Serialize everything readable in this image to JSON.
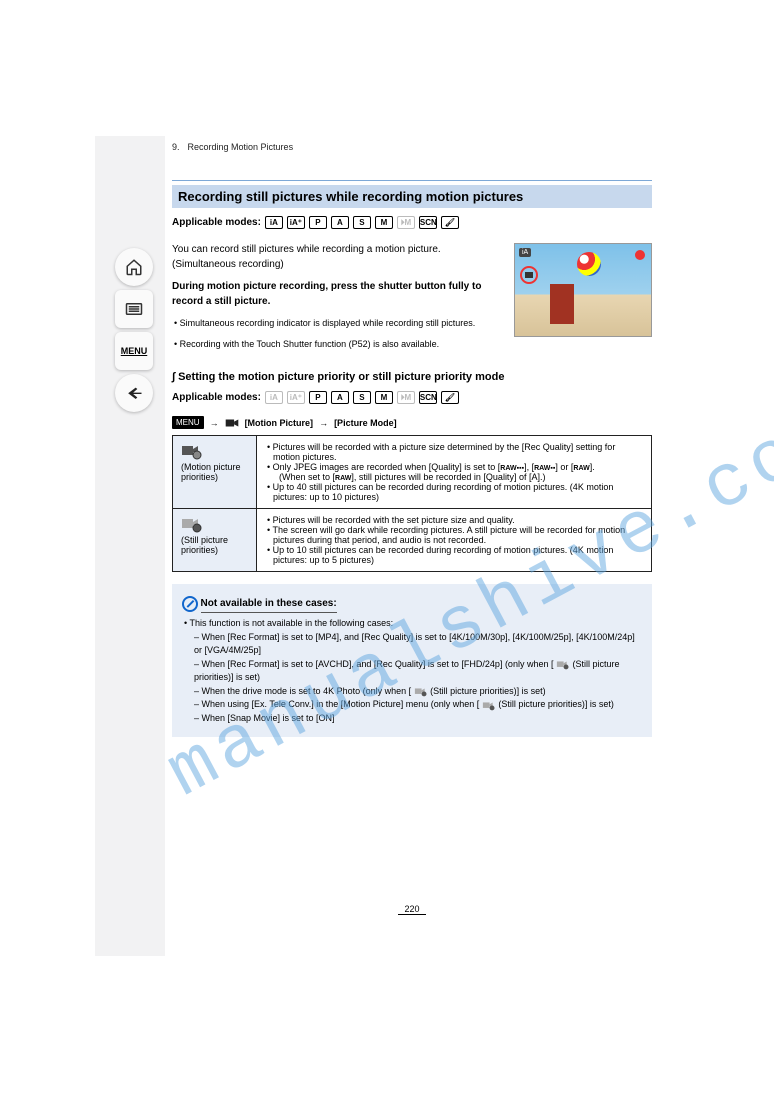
{
  "header": {
    "left": "Recording Motion Pictures",
    "right": "9."
  },
  "nav": {
    "menu_label": "MENU"
  },
  "section1": {
    "title": "Recording still pictures while recording motion pictures",
    "applicable_label": "Applicable modes:",
    "modes": [
      "iA",
      "iA+",
      "P",
      "A",
      "S",
      "M",
      "vM",
      "SCN",
      "CrA"
    ],
    "para1": "You can record still pictures while recording a motion picture. (Simultaneous recording)",
    "step": "During motion picture recording, press the shutter button fully to record a still picture.",
    "note1": "Simultaneous recording indicator is displayed while recording still pictures.",
    "note2": "Recording with the Touch Shutter function (P52) is also available."
  },
  "photo_badge": "iA",
  "section2": {
    "title": "Setting the motion picture priority or still picture priority mode",
    "applicable_label": "Applicable modes:",
    "menu_path": {
      "chip": "MENU",
      "arrow": "→",
      "cat": "[Motion Picture]",
      "item": "[Picture Mode]"
    }
  },
  "table": {
    "row1": {
      "head": "(Motion picture priorities)",
      "l1": "Pictures will be recorded with a picture size determined by the [Rec Quality] setting for motion pictures.",
      "l2": "Only JPEG images are recorded when [Quality] is set to [",
      "l2b": "], [",
      "l2c": "] or [",
      "raw_word": "RAW",
      "l2d": "].",
      "l3_pre": "(When set to [",
      "l3_post": "], still pictures will be recorded in [Quality] of [A].)",
      "l4": "Up to 40 still pictures can be recorded during recording of motion pictures. (4K motion pictures: up to 10 pictures)"
    },
    "row2": {
      "head": "(Still picture priorities)",
      "l1": "Pictures will be recorded with the set picture size and quality.",
      "l2": "The screen will go dark while recording pictures. A still picture will be recorded for motion pictures during that period, and audio is not recorded.",
      "l3": "Up to 10 still pictures can be recorded during recording of motion pictures. (4K motion pictures: up to 5 pictures)"
    }
  },
  "notes": {
    "na_header": "Not available in these cases:",
    "bullets": [
      "This function is not available in the following cases:",
      "– When [Rec Format] is set to [MP4], and [Rec Quality] is set to [4K/100M/30p], [4K/100M/25p], [4K/100M/24p] or [VGA/4M/25p]",
      "– When [Rec Format] is set to [AVCHD], and [Rec Quality] is set to [FHD/24p] (only when [",
      "  (Still picture priorities)] is set)",
      "– When the drive mode is set to 4K Photo (only when [",
      "  (Still picture priorities)] is set)",
      "– When using [Ex. Tele Conv.] in the [Motion Picture] menu (only when [",
      "  (Still picture priorities)] is set)",
      "– When [Snap Movie] is set to [ON]"
    ]
  },
  "page_number": "220",
  "watermark": "manualshive.com"
}
